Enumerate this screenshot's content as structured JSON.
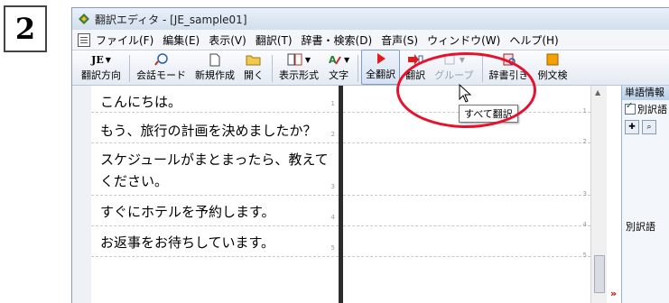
{
  "step": {
    "number": "2"
  },
  "window": {
    "title": "翻訳エディタ - [JE_sample01]"
  },
  "menu": {
    "items": [
      "ファイル(F)",
      "編集(E)",
      "表示(V)",
      "翻訳(T)",
      "辞書・検索(D)",
      "音声(S)",
      "ウィンドウ(W)",
      "ヘルプ(H)"
    ]
  },
  "toolbar": {
    "direction_icon": "JE",
    "direction_label": "翻訳方向",
    "conversation_label": "会話モード",
    "new_label": "新規作成",
    "open_label": "開く",
    "display_label": "表示形式",
    "text_label": "文字",
    "translate_all_label": "全翻訳",
    "translate_label": "翻訳",
    "group_label": "グループ",
    "dict_label": "辞書引き",
    "examples_label": "例文検"
  },
  "tooltip": {
    "text": "すべて翻訳"
  },
  "rows": [
    {
      "text": "こんにちは。",
      "num": "1"
    },
    {
      "text": "もう、旅行の計画を決めましたか？",
      "num": "2"
    },
    {
      "text": "スケジュールがまとまったら、教えてください。",
      "num": "3"
    },
    {
      "text": "すぐにホテルを予約します。",
      "num": "4"
    },
    {
      "text": "お返事をお待ちしています。",
      "num": "5"
    }
  ],
  "side_panel": {
    "title": "単語情報",
    "checkbox_label": "別訳語",
    "field_label": "別訳語"
  },
  "colors": {
    "highlight": "#e8112d",
    "title_bg": "#d3dfee"
  }
}
